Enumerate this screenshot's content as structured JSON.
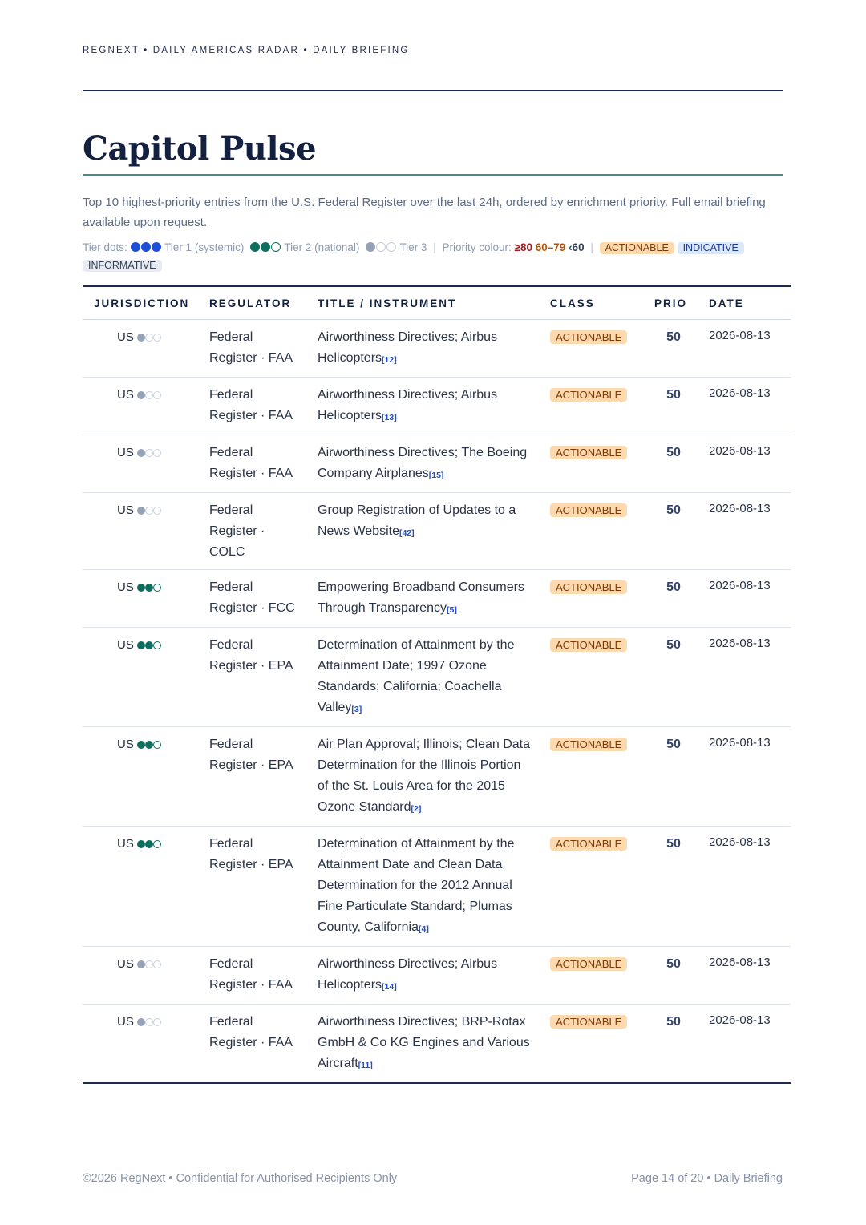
{
  "header": {
    "running_head": "REGNEXT • DAILY AMERICAS RADAR • DAILY BRIEFING"
  },
  "title": "Capitol Pulse",
  "intro": "Top 10 highest-priority entries from the U.S. Federal Register over the last 24h, ordered by enrichment priority. Full email briefing available upon request.",
  "legend": {
    "label": "Tier dots:",
    "tier1": "Tier 1 (systemic)",
    "tier2": "Tier 2 (national)",
    "tier3": "Tier 3",
    "separator": "|",
    "priority_label": "Priority colour:",
    "prio_high": "≥80",
    "prio_mid": "60–79",
    "prio_low": "‹60",
    "class_actionable": "ACTIONABLE",
    "class_indicative": "INDICATIVE",
    "class_informative": "INFORMATIVE"
  },
  "colors": {
    "navy": "#1b2a4e",
    "teal_rule": "#3f8f83",
    "tier1": "#1d4ed8",
    "tier2": "#0f6e60",
    "tier3": "#94a3b8",
    "prio_high": "#9b1c1c",
    "prio_mid": "#b45309",
    "actionable_bg": "#fcd9ae"
  },
  "table": {
    "columns": [
      "JURISDICTION",
      "REGULATOR",
      "TITLE / INSTRUMENT",
      "CLASS",
      "PRIO",
      "DATE"
    ],
    "rows": [
      {
        "jurisdiction": "US",
        "tier": 3,
        "regulator": "Federal Register · FAA",
        "title": "Airworthiness Directives; Airbus Helicopters",
        "cite": "[12]",
        "class": "ACTIONABLE",
        "prio": "50",
        "date": "2026-08-13"
      },
      {
        "jurisdiction": "US",
        "tier": 3,
        "regulator": "Federal Register · FAA",
        "title": "Airworthiness Directives; Airbus Helicopters",
        "cite": "[13]",
        "class": "ACTIONABLE",
        "prio": "50",
        "date": "2026-08-13"
      },
      {
        "jurisdiction": "US",
        "tier": 3,
        "regulator": "Federal Register · FAA",
        "title": "Airworthiness Directives; The Boeing Company Airplanes",
        "cite": "[15]",
        "class": "ACTIONABLE",
        "prio": "50",
        "date": "2026-08-13"
      },
      {
        "jurisdiction": "US",
        "tier": 3,
        "regulator": "Federal Register · COLC",
        "title": "Group Registration of Updates to a News Website",
        "cite": "[42]",
        "class": "ACTIONABLE",
        "prio": "50",
        "date": "2026-08-13"
      },
      {
        "jurisdiction": "US",
        "tier": 2,
        "regulator": "Federal Register · FCC",
        "title": "Empowering Broadband Consumers Through Transparency",
        "cite": "[5]",
        "class": "ACTIONABLE",
        "prio": "50",
        "date": "2026-08-13"
      },
      {
        "jurisdiction": "US",
        "tier": 2,
        "regulator": "Federal Register · EPA",
        "title": "Determination of Attainment by the Attainment Date; 1997 Ozone Standards; California; Coachella Valley",
        "cite": "[3]",
        "class": "ACTIONABLE",
        "prio": "50",
        "date": "2026-08-13"
      },
      {
        "jurisdiction": "US",
        "tier": 2,
        "regulator": "Federal Register · EPA",
        "title": "Air Plan Approval; Illinois; Clean Data Determination for the Illinois Portion of the St. Louis Area for the 2015 Ozone Standard",
        "cite": "[2]",
        "class": "ACTIONABLE",
        "prio": "50",
        "date": "2026-08-13"
      },
      {
        "jurisdiction": "US",
        "tier": 2,
        "regulator": "Federal Register · EPA",
        "title": "Determination of Attainment by the Attainment Date and Clean Data Determination for the 2012 Annual Fine Particulate Standard; Plumas County, California",
        "cite": "[4]",
        "class": "ACTIONABLE",
        "prio": "50",
        "date": "2026-08-13"
      },
      {
        "jurisdiction": "US",
        "tier": 3,
        "regulator": "Federal Register · FAA",
        "title": "Airworthiness Directives; Airbus Helicopters",
        "cite": "[14]",
        "class": "ACTIONABLE",
        "prio": "50",
        "date": "2026-08-13"
      },
      {
        "jurisdiction": "US",
        "tier": 3,
        "regulator": "Federal Register · FAA",
        "title": "Airworthiness Directives; BRP-Rotax GmbH & Co KG Engines and Various Aircraft",
        "cite": "[11]",
        "class": "ACTIONABLE",
        "prio": "50",
        "date": "2026-08-13"
      }
    ]
  },
  "footer": {
    "left": "©2026 RegNext • Confidential for Authorised Recipients Only",
    "right": "Page 14 of 20 • Daily Briefing"
  }
}
